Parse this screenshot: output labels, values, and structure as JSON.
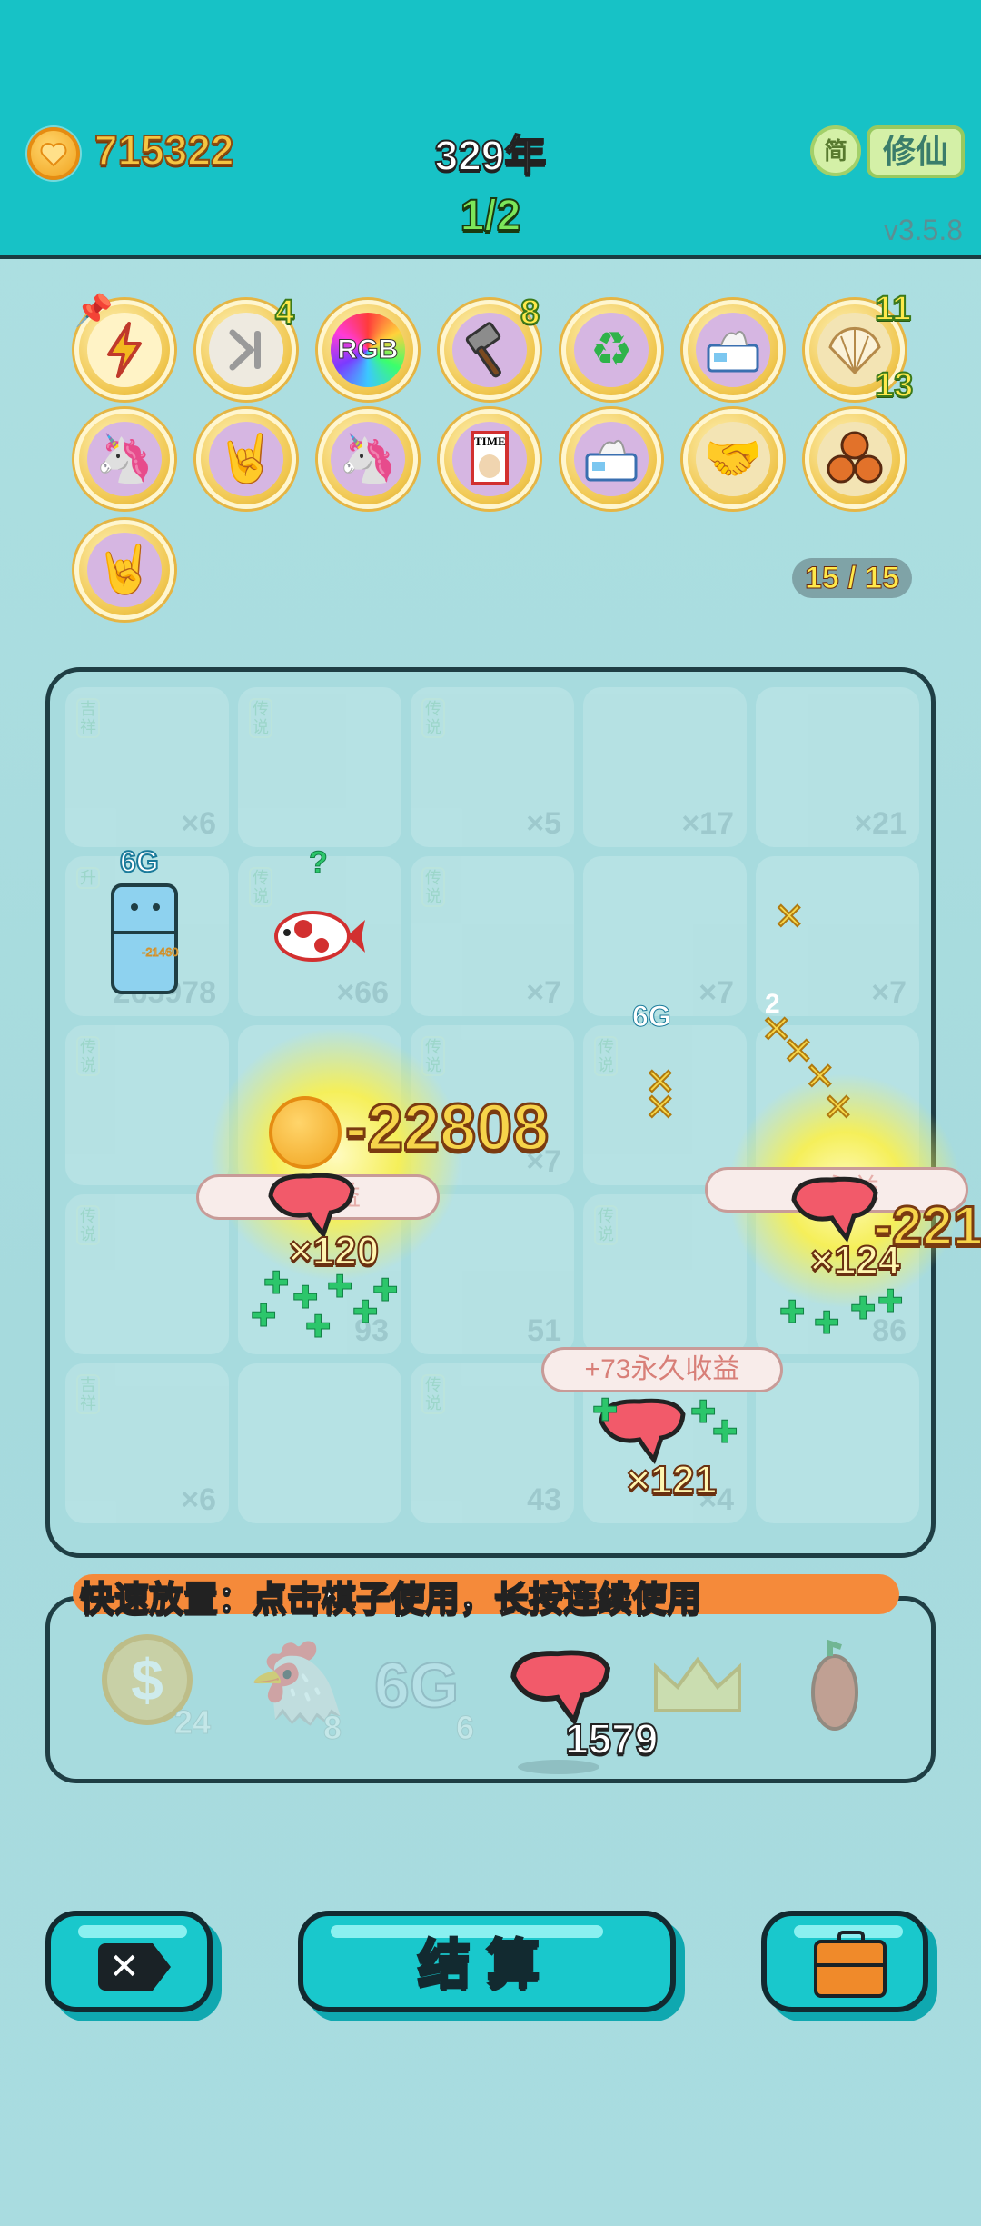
{
  "header": {
    "coins": "715322",
    "year": "329年",
    "round": "1/2",
    "lang_button": "简",
    "mode_button": "修仙",
    "version": "v3.5.8"
  },
  "buffs": {
    "row1": [
      {
        "icon": "lightning-icon",
        "badge": ""
      },
      {
        "icon": "skip-icon",
        "badge": "4"
      },
      {
        "icon": "rgb-icon",
        "label": "RGB",
        "badge": ""
      },
      {
        "icon": "hammer-icon",
        "badge": "8"
      },
      {
        "icon": "recycle-icon",
        "badge": ""
      },
      {
        "icon": "tissue-box-icon",
        "badge": ""
      },
      {
        "icon": "shell-icon",
        "badge": "11",
        "badge2": "13"
      }
    ],
    "row2": [
      {
        "icon": "unicorn-icon"
      },
      {
        "icon": "rock-hand-icon"
      },
      {
        "icon": "unicorn-icon"
      },
      {
        "icon": "time-magazine-icon",
        "label": "TIME"
      },
      {
        "icon": "tissue-box-icon"
      },
      {
        "icon": "handshake-icon"
      },
      {
        "icon": "basketballs-icon"
      }
    ],
    "row3": [
      {
        "icon": "rock-hand-icon"
      }
    ],
    "count": "15 / 15"
  },
  "board": {
    "cells": [
      {
        "tag": "吉祥",
        "mult": "×6"
      },
      {
        "tag": "传说",
        "mult": ""
      },
      {
        "tag": "传说",
        "mult": "×5"
      },
      {
        "tag": "",
        "mult": "×17"
      },
      {
        "tag": "",
        "mult": "×21"
      },
      {
        "tag": "升",
        "mult": "265978"
      },
      {
        "tag": "传说",
        "mult": "×66"
      },
      {
        "tag": "传说",
        "mult": "×7"
      },
      {
        "tag": "",
        "mult": "×7"
      },
      {
        "tag": "",
        "mult": "×7"
      },
      {
        "tag": "传说",
        "mult": ""
      },
      {
        "tag": "",
        "mult": ""
      },
      {
        "tag": "传说",
        "mult": "×7"
      },
      {
        "tag": "传说",
        "mult": ""
      },
      {
        "tag": "",
        "mult": ""
      },
      {
        "tag": "传说",
        "mult": ""
      },
      {
        "tag": "",
        "mult": "93"
      },
      {
        "tag": "",
        "mult": "51"
      },
      {
        "tag": "传说",
        "mult": ""
      },
      {
        "tag": "",
        "mult": "86"
      },
      {
        "tag": "吉祥",
        "mult": "×6"
      },
      {
        "tag": "",
        "mult": ""
      },
      {
        "tag": "传说",
        "mult": "43"
      },
      {
        "tag": "",
        "mult": "×4"
      },
      {
        "tag": "",
        "mult": ""
      }
    ],
    "fridge_label": "6G",
    "fridge_value": "-21460",
    "fish_question": "?",
    "gain_label_6g": "6G",
    "big_number": "-22808",
    "big_number_right": "-221",
    "liver_left_mult": "×120",
    "liver_right_mult": "×124",
    "liver_bottom_mult": "×121",
    "pill_left": "+7",
    "pill_left_suffix": "永益",
    "pill_right": "+8",
    "pill_right_suffix": "永益",
    "pill_bottom": "+73永久收益",
    "right_small": "2"
  },
  "quick_place": {
    "label": "快速放置：点击棋子使用，长按连续使用",
    "items": [
      {
        "icon": "coin-dollar-icon",
        "count": "24"
      },
      {
        "icon": "bird-icon",
        "count": "8"
      },
      {
        "icon": "6g-icon",
        "label": "6G",
        "count": "6"
      },
      {
        "icon": "liver-icon",
        "count": "1579"
      },
      {
        "icon": "crown-icon",
        "count": ""
      },
      {
        "icon": "pepper-icon",
        "count": ""
      }
    ]
  },
  "buttons": {
    "close": "✕",
    "settle": "结算",
    "bag": "bag"
  },
  "colors": {
    "header_bg": "#17c2c6",
    "page_bg": "#a7dbde",
    "gold": "#f5c542",
    "orange_bar": "#f58a3a"
  }
}
